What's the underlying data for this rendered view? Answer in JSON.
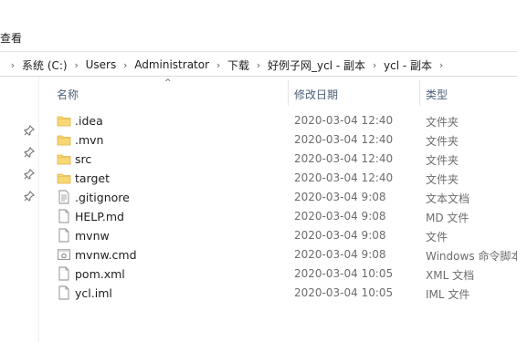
{
  "ribbon": {
    "view_label": "查看"
  },
  "breadcrumb": [
    "系统 (C:)",
    "Users",
    "Administrator",
    "下载",
    "好例子网_ycl - 副本",
    "ycl - 副本"
  ],
  "columns": {
    "name": "名称",
    "date": "修改日期",
    "type": "类型"
  },
  "files": [
    {
      "name": ".idea",
      "date": "2020-03-04 12:40",
      "type": "文件夹",
      "icon": "folder-icon"
    },
    {
      "name": ".mvn",
      "date": "2020-03-04 12:40",
      "type": "文件夹",
      "icon": "folder-icon"
    },
    {
      "name": "src",
      "date": "2020-03-04 12:40",
      "type": "文件夹",
      "icon": "folder-icon"
    },
    {
      "name": "target",
      "date": "2020-03-04 12:40",
      "type": "文件夹",
      "icon": "folder-icon"
    },
    {
      "name": ".gitignore",
      "date": "2020-03-04 9:08",
      "type": "文本文档",
      "icon": "text-file-icon"
    },
    {
      "name": "HELP.md",
      "date": "2020-03-04 9:08",
      "type": "MD 文件",
      "icon": "file-icon"
    },
    {
      "name": "mvnw",
      "date": "2020-03-04 9:08",
      "type": "文件",
      "icon": "file-icon"
    },
    {
      "name": "mvnw.cmd",
      "date": "2020-03-04 9:08",
      "type": "Windows 命令脚本",
      "icon": "script-file-icon"
    },
    {
      "name": "pom.xml",
      "date": "2020-03-04 10:05",
      "type": "XML 文档",
      "icon": "file-icon"
    },
    {
      "name": "ycl.iml",
      "date": "2020-03-04 10:05",
      "type": "IML 文件",
      "icon": "file-icon"
    }
  ],
  "colors": {
    "folder": "#f8d775",
    "header_text": "#4c607a",
    "meta_text": "#6d6d6d"
  }
}
